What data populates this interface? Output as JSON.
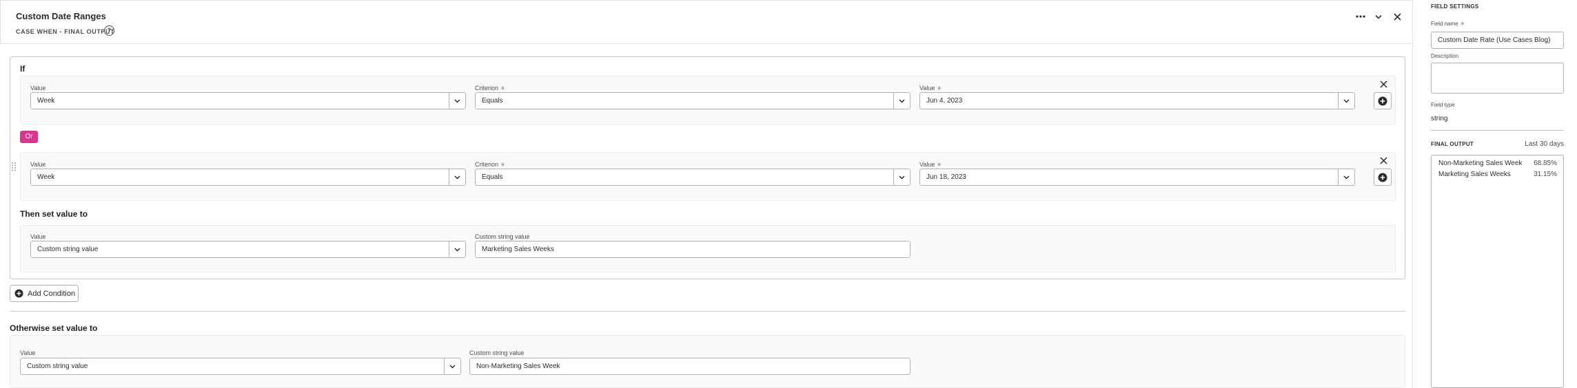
{
  "header": {
    "title": "Custom Date Ranges",
    "subtitle": "CASE WHEN - FINAL OUTPUT",
    "help_glyph": "?"
  },
  "if_block": {
    "label": "If",
    "or_label": "Or",
    "rows": [
      {
        "left_label": "Value",
        "left_value": "Week",
        "mid_label": "Criterion",
        "mid_value": "Equals",
        "right_label": "Value",
        "right_value": "Jun 4, 2023"
      },
      {
        "left_label": "Value",
        "left_value": "Week",
        "mid_label": "Criterion",
        "mid_value": "Equals",
        "right_label": "Value",
        "right_value": "Jun 18, 2023"
      }
    ],
    "required_mark": "✳"
  },
  "then_block": {
    "label": "Then set value to",
    "value_label": "Value",
    "value": "Custom string value",
    "custom_label": "Custom string value",
    "custom_value": "Marketing Sales Weeks"
  },
  "add_condition": {
    "label": "Add Condition"
  },
  "otherwise_block": {
    "label": "Otherwise set value to",
    "value_label": "Value",
    "value": "Custom string value",
    "custom_label": "Custom string value",
    "custom_value": "Non-Marketing Sales Week"
  },
  "side": {
    "heading": "FIELD SETTINGS",
    "field_name_label": "Field name",
    "field_name_value": "Custom Date Rate (Use Cases Blog)",
    "description_label": "Description",
    "description_value": "",
    "field_type_label": "Field type",
    "field_type_value": "string",
    "final_output_label": "FINAL OUTPUT",
    "final_output_range": "Last 30 days",
    "outputs": [
      {
        "name": "Non-Marketing Sales Week",
        "pct": "68.85%"
      },
      {
        "name": "Marketing Sales Weeks",
        "pct": "31.15%"
      }
    ]
  },
  "colors": {
    "or_badge": "#d83790",
    "border": "#b1b1b1",
    "card_bg": "#fafafa"
  },
  "icons": [
    "more-icon",
    "chevron-down-icon",
    "close-icon",
    "help-icon",
    "add-circle-icon",
    "drag-handle-icon"
  ]
}
